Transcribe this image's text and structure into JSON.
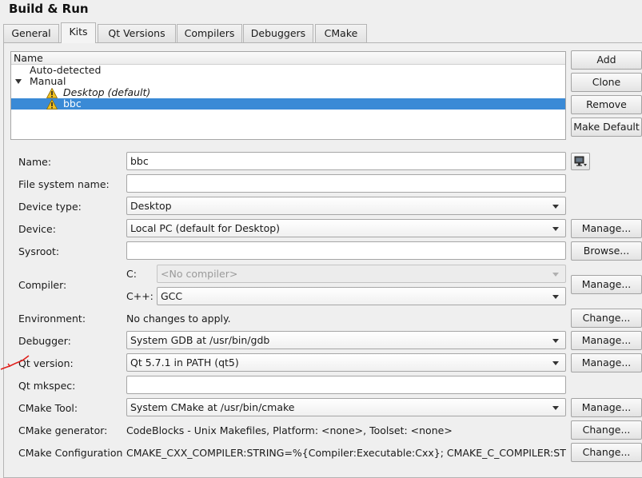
{
  "window": {
    "title": "Build & Run"
  },
  "tabs": [
    "General",
    "Kits",
    "Qt Versions",
    "Compilers",
    "Debuggers",
    "CMake"
  ],
  "active_tab": "Kits",
  "kits_tree": {
    "header": "Name",
    "groups": [
      {
        "label": "Auto-detected"
      },
      {
        "label": "Manual",
        "expanded": true,
        "items": [
          {
            "label": "Desktop (default)",
            "warning": true,
            "italic": true
          },
          {
            "label": "bbc",
            "warning": true,
            "selected": true
          }
        ]
      }
    ]
  },
  "side_buttons": {
    "add": "Add",
    "clone": "Clone",
    "remove": "Remove",
    "make_default": "Make Default"
  },
  "form": {
    "name": {
      "label": "Name:",
      "value": "bbc"
    },
    "fs_name": {
      "label": "File system name:",
      "value": ""
    },
    "device_type": {
      "label": "Device type:",
      "value": "Desktop"
    },
    "device": {
      "label": "Device:",
      "value": "Local PC (default for Desktop)",
      "button": "Manage..."
    },
    "sysroot": {
      "label": "Sysroot:",
      "value": "",
      "button": "Browse..."
    },
    "compiler": {
      "label": "Compiler:",
      "c_label": "C:",
      "c_value": "<No compiler>",
      "cxx_label": "C++:",
      "cxx_value": "GCC",
      "button": "Manage..."
    },
    "environment": {
      "label": "Environment:",
      "value": "No changes to apply.",
      "button": "Change..."
    },
    "debugger": {
      "label": "Debugger:",
      "value": "System GDB at /usr/bin/gdb",
      "button": "Manage..."
    },
    "qt_version": {
      "label": "Qt version:",
      "value": "Qt 5.7.1 in PATH (qt5)",
      "button": "Manage..."
    },
    "qt_mkspec": {
      "label": "Qt mkspec:",
      "value": ""
    },
    "cmake_tool": {
      "label": "CMake Tool:",
      "value": "System CMake at /usr/bin/cmake",
      "button": "Manage..."
    },
    "cmake_generator": {
      "label": "CMake generator:",
      "value": "CodeBlocks - Unix Makefiles, Platform: <none>, Toolset: <none>",
      "button": "Change..."
    },
    "cmake_config": {
      "label": "CMake Configuration",
      "value": "CMAKE_CXX_COMPILER:STRING=%{Compiler:Executable:Cxx}; CMAKE_C_COMPILER:STRI...",
      "button": "Change..."
    }
  },
  "colors": {
    "selection": "#3a8ad6",
    "annotation": "#e0201c",
    "warning": "#f0c020"
  }
}
